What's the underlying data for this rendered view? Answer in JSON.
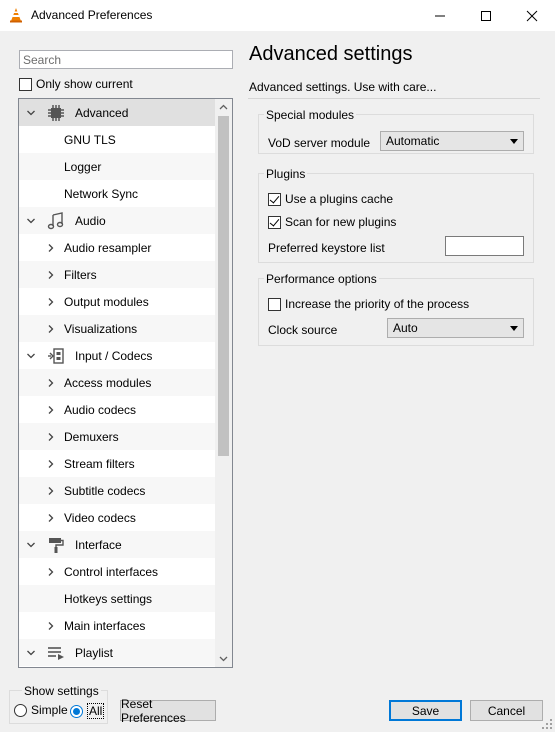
{
  "window": {
    "title": "Advanced Preferences",
    "icon": "vlc-cone-icon"
  },
  "sidebar": {
    "search_placeholder": "Search",
    "only_show_current": {
      "label": "Only show current",
      "checked": false
    },
    "tree": [
      {
        "label": "Advanced",
        "kind": "category",
        "expanded": true,
        "selected": true,
        "icon": "chip-icon"
      },
      {
        "label": "GNU TLS",
        "kind": "leaf"
      },
      {
        "label": "Logger",
        "kind": "leaf"
      },
      {
        "label": "Network Sync",
        "kind": "leaf"
      },
      {
        "label": "Audio",
        "kind": "category",
        "expanded": true,
        "icon": "music-note-icon"
      },
      {
        "label": "Audio resampler",
        "kind": "child"
      },
      {
        "label": "Filters",
        "kind": "child"
      },
      {
        "label": "Output modules",
        "kind": "child"
      },
      {
        "label": "Visualizations",
        "kind": "child"
      },
      {
        "label": "Input / Codecs",
        "kind": "category",
        "expanded": true,
        "icon": "codec-icon"
      },
      {
        "label": "Access modules",
        "kind": "child"
      },
      {
        "label": "Audio codecs",
        "kind": "child"
      },
      {
        "label": "Demuxers",
        "kind": "child"
      },
      {
        "label": "Stream filters",
        "kind": "child"
      },
      {
        "label": "Subtitle codecs",
        "kind": "child"
      },
      {
        "label": "Video codecs",
        "kind": "child"
      },
      {
        "label": "Interface",
        "kind": "category",
        "expanded": true,
        "icon": "paint-roller-icon"
      },
      {
        "label": "Control interfaces",
        "kind": "child"
      },
      {
        "label": "Hotkeys settings",
        "kind": "leaf"
      },
      {
        "label": "Main interfaces",
        "kind": "child"
      },
      {
        "label": "Playlist",
        "kind": "category",
        "expanded": true,
        "icon": "playlist-icon"
      }
    ]
  },
  "main": {
    "title": "Advanced settings",
    "description": "Advanced settings. Use with care...",
    "special_modules": {
      "title": "Special modules",
      "vod_label": "VoD server module",
      "vod_value": "Automatic"
    },
    "plugins": {
      "title": "Plugins",
      "use_cache": {
        "label": "Use a plugins cache",
        "checked": true
      },
      "scan_new": {
        "label": "Scan for new plugins",
        "checked": true
      },
      "keystore_label": "Preferred keystore list",
      "keystore_value": ""
    },
    "performance": {
      "title": "Performance options",
      "increase_priority": {
        "label": "Increase the priority of the process",
        "checked": false
      },
      "clock_label": "Clock source",
      "clock_value": "Auto"
    }
  },
  "footer": {
    "show_settings_label": "Show settings",
    "simple_label": "Simple",
    "all_label": "All",
    "selected_mode": "All",
    "reset_label": "Reset Preferences",
    "save_label": "Save",
    "cancel_label": "Cancel"
  }
}
